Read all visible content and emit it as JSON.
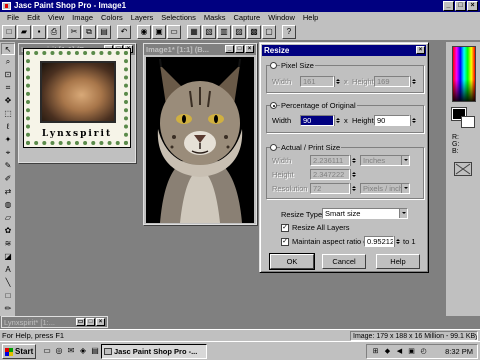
{
  "app": {
    "title": "Jasc Paint Shop Pro - Image1"
  },
  "menu": [
    "File",
    "Edit",
    "View",
    "Image",
    "Colors",
    "Layers",
    "Selections",
    "Masks",
    "Capture",
    "Window",
    "Help"
  ],
  "toolbar_icons": [
    "new-icon",
    "open-icon",
    "save-icon",
    "print-icon",
    "cut-icon",
    "copy-icon",
    "paste-icon",
    "undo-icon",
    "zoom-icon",
    "normal-view-icon",
    "full-screen-icon",
    "tool-palette-icon",
    "control-palette-icon",
    "color-palette-icon",
    "histogram-icon",
    "layer-palette-icon",
    "overview-icon",
    "help-icon"
  ],
  "toolbar_glyphs": [
    "□",
    "▰",
    "▪",
    "⎙",
    "✂",
    "⧉",
    "▤",
    "↶",
    "◉",
    "▣",
    "▭",
    "▦",
    "▧",
    "▥",
    "▨",
    "▩",
    "▢",
    "?"
  ],
  "tools": [
    "arrow",
    "zoom",
    "deformation",
    "crop",
    "mover",
    "selection",
    "freehand",
    "magic-wand",
    "dropper",
    "paint-brush",
    "clone-brush",
    "color-replacer",
    "retouch",
    "eraser",
    "picture-tube",
    "airbrush",
    "flood-fill",
    "text",
    "line",
    "shape",
    "draw",
    "vector"
  ],
  "tool_glyphs": [
    "↖",
    "⌕",
    "⊡",
    "⌗",
    "✥",
    "⬚",
    "ℓ",
    "✦",
    "⌖",
    "✎",
    "✐",
    "⇄",
    "◍",
    "▱",
    "✿",
    "≋",
    "◪",
    "A",
    "╲",
    "□",
    "✏",
    "⬡"
  ],
  "doc1": {
    "title": "Lynxspirit [1:1] (Ba...",
    "caption": "Lynxspirit"
  },
  "doc2": {
    "title": "Image1* [1:1] (B..."
  },
  "dialog": {
    "title": "Resize",
    "pixel_size": {
      "label": "Pixel Size",
      "width_label": "Width",
      "width": "161",
      "x": "x",
      "height_label": "Height",
      "height": "169"
    },
    "percentage": {
      "label": "Percentage of Original",
      "width_label": "Width",
      "width": "90",
      "x": "x",
      "height_label": "Height",
      "height": "90"
    },
    "actual": {
      "label": "Actual / Print Size",
      "width_label": "Width",
      "width": "2.236111",
      "width_units": "Inches",
      "height_label": "Height",
      "height": "2.347222",
      "resolution_label": "Resolution",
      "resolution": "72",
      "resolution_units": "Pixels / inch"
    },
    "resize_type_label": "Resize Type",
    "resize_type": "Smart size",
    "resize_all_layers": "Resize All Layers",
    "maintain_aspect": "Maintain aspect ratio of",
    "aspect_value": "0.952127",
    "aspect_suffix": "to 1",
    "ok": "OK",
    "cancel": "Cancel",
    "help": "Help"
  },
  "right_panel": {
    "rgb": [
      "R:",
      "G:",
      "B:"
    ]
  },
  "minimized": {
    "title": "Lynxspirit* [1:..."
  },
  "status": {
    "help": "For Help, press F1",
    "info": "Image:  179 x 188 x 16 Million - 99.1 KBytes"
  },
  "taskbar": {
    "start": "Start",
    "task": "Jasc Paint Shop Pro -...",
    "clock": "8:32 PM"
  },
  "colors": {
    "title_active": "#000080",
    "face": "#c0c0c0",
    "workspace": "#808080"
  }
}
